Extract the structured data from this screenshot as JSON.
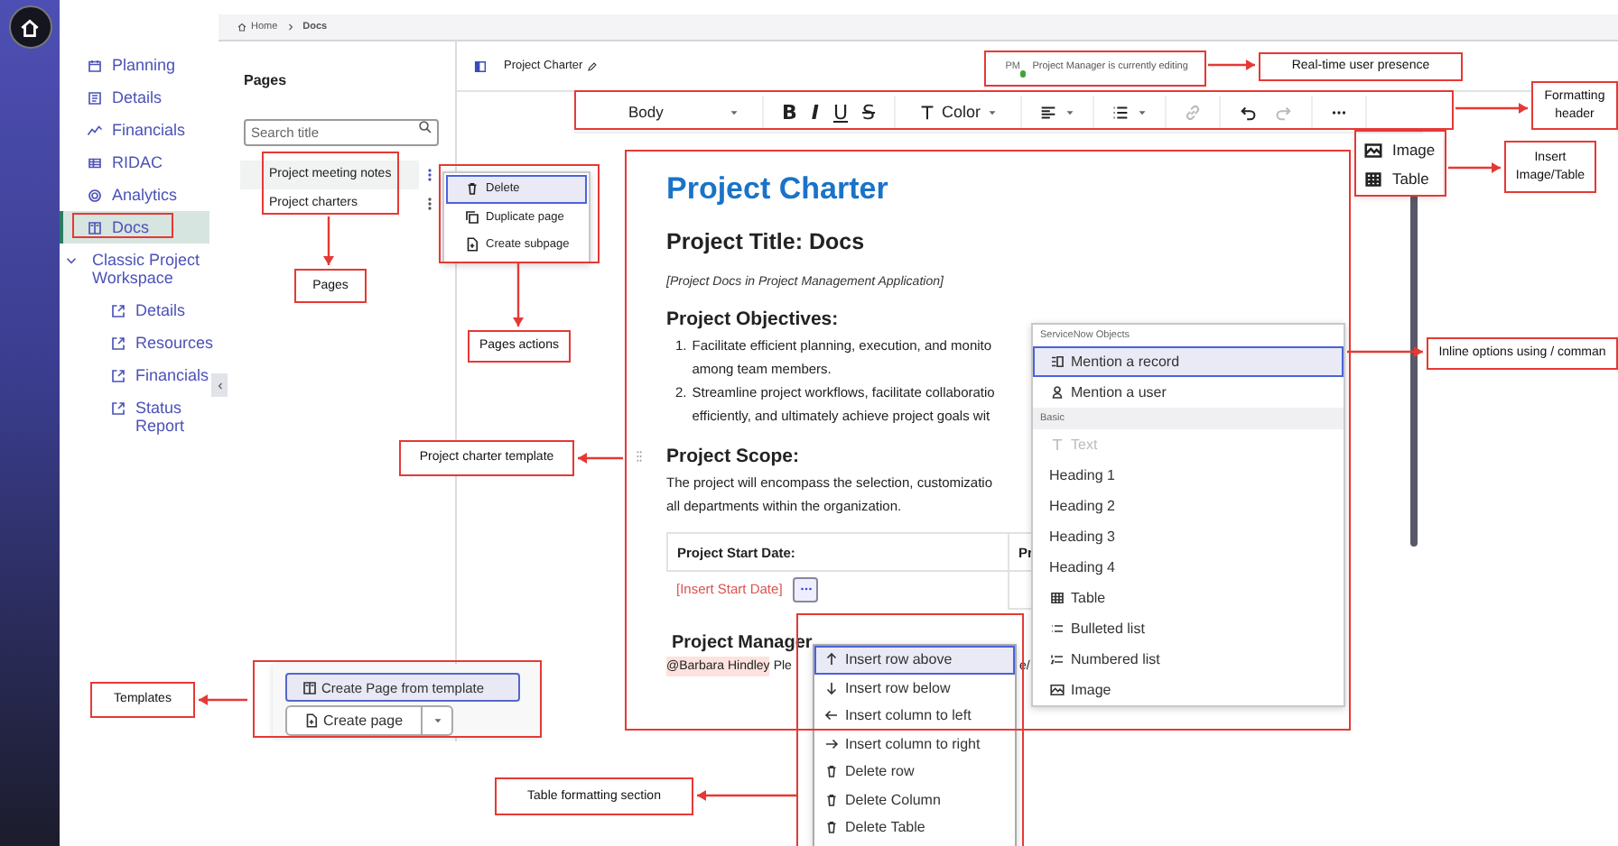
{
  "breadcrumb": [
    {
      "label": "Home"
    },
    {
      "label": "Docs"
    }
  ],
  "sidebar": {
    "items": [
      {
        "label": "Planning",
        "selected": false
      },
      {
        "label": "Details",
        "selected": false
      },
      {
        "label": "Financials",
        "selected": false
      },
      {
        "label": "RIDAC",
        "selected": false
      },
      {
        "label": "Analytics",
        "selected": false
      },
      {
        "label": "Docs",
        "selected": true
      },
      {
        "label": "Classic Project Workspace",
        "selected": false,
        "expanded": true,
        "children": [
          {
            "label": "Details",
            "selected": false
          },
          {
            "label": "Resources",
            "selected": false
          },
          {
            "label": "Financials",
            "selected": false
          },
          {
            "label": "Status Report",
            "selected": false
          }
        ]
      }
    ]
  },
  "pages_panel": {
    "title": "Pages",
    "search": {
      "placeholder": "Search title"
    },
    "pages": [
      {
        "title": "Project meeting notes",
        "selected": true
      },
      {
        "title": "Project charters",
        "selected": false
      }
    ]
  },
  "page_actions_menu": {
    "items": [
      {
        "label": "Delete",
        "selected": true
      },
      {
        "label": "Duplicate page",
        "selected": false
      },
      {
        "label": "Create subpage",
        "selected": false
      }
    ]
  },
  "editor": {
    "title": "Project Charter",
    "presence": {
      "initials": "PM",
      "online": true,
      "text": "Project Manager is currently editing"
    },
    "toolbar": {
      "style": "Body",
      "formats": [
        "B",
        "I",
        "U",
        "S"
      ],
      "color_label": "Color",
      "link_disabled": true,
      "redo_disabled": true
    },
    "insert_menu": {
      "items": [
        {
          "label": "Image",
          "kind": "image"
        },
        {
          "label": "Table",
          "kind": "table"
        }
      ]
    },
    "document": {
      "heading": "Project Charter",
      "title": "Project Title: Docs",
      "subtitle": "[Project Docs in Project Management Application]",
      "objectives": {
        "heading": "Project Objectives:",
        "items": [
          {
            "number": "1.",
            "lines": [
              "Facilitate efficient planning, execution, and monito",
              "among team members."
            ]
          },
          {
            "number": "2.",
            "lines": [
              "Streamline project workflows, facilitate collaboratio",
              "efficiently, and ultimately achieve project goals wit"
            ]
          }
        ]
      },
      "scope": {
        "heading": "Project Scope:",
        "lines": [
          "The project will encompass the selection, customizatio",
          "all departments within the organization."
        ]
      },
      "table": {
        "headers": [
          "Project Start Date:",
          "Pr"
        ],
        "cells": [
          "[Insert Start Date]"
        ]
      },
      "manager": {
        "heading": "Project Manager",
        "mention": "@Barbara Hindley",
        "text": "Ple",
        "tail": "e/"
      }
    }
  },
  "slash_menu": {
    "groups": [
      {
        "heading": "ServiceNow Objects",
        "items": [
          {
            "label": "Mention a record",
            "kind": "record",
            "selected": true,
            "disabled": false
          },
          {
            "label": "Mention a user",
            "kind": "user",
            "selected": false,
            "disabled": false
          }
        ]
      },
      {
        "heading": "Basic",
        "items": [
          {
            "label": "Text",
            "kind": "text",
            "selected": false,
            "disabled": true
          },
          {
            "label": "Heading 1",
            "kind": "heading",
            "selected": false,
            "disabled": false
          },
          {
            "label": "Heading 2",
            "kind": "heading",
            "selected": false,
            "disabled": false
          },
          {
            "label": "Heading 3",
            "kind": "heading",
            "selected": false,
            "disabled": false
          },
          {
            "label": "Heading 4",
            "kind": "heading",
            "selected": false,
            "disabled": false
          },
          {
            "label": "Table",
            "kind": "table",
            "selected": false,
            "disabled": false
          },
          {
            "label": "Bulleted list",
            "kind": "bullets",
            "selected": false,
            "disabled": false
          },
          {
            "label": "Numbered list",
            "kind": "numbers",
            "selected": false,
            "disabled": false
          },
          {
            "label": "Image",
            "kind": "image",
            "selected": false,
            "disabled": false
          }
        ]
      }
    ]
  },
  "table_menu": {
    "items": [
      {
        "label": "Insert row above",
        "kind": "above",
        "selected": true
      },
      {
        "label": "Insert row below",
        "kind": "below",
        "selected": false
      },
      {
        "label": "Insert column to left",
        "kind": "left",
        "selected": false
      },
      {
        "label": "Insert column to right",
        "kind": "right",
        "selected": false
      },
      {
        "label": "Delete row",
        "kind": "delete",
        "selected": false
      },
      {
        "label": "Delete Column",
        "kind": "delete",
        "selected": false
      },
      {
        "label": "Delete Table",
        "kind": "delete",
        "selected": false
      }
    ]
  },
  "templates_popup": {
    "template_button": {
      "label": "Create Page from template",
      "selected": true
    },
    "create_button": {
      "label": "Create page"
    }
  },
  "annotations": [
    {
      "text": "Pages"
    },
    {
      "text": "Pages actions"
    },
    {
      "text": "Real-time user presence"
    },
    {
      "text": "Formatting header"
    },
    {
      "text": "Insert Image/Table"
    },
    {
      "text": "Project charter template"
    },
    {
      "text": "Inline options using / comman"
    },
    {
      "text": "Templates"
    },
    {
      "text": "Table formatting section"
    }
  ]
}
